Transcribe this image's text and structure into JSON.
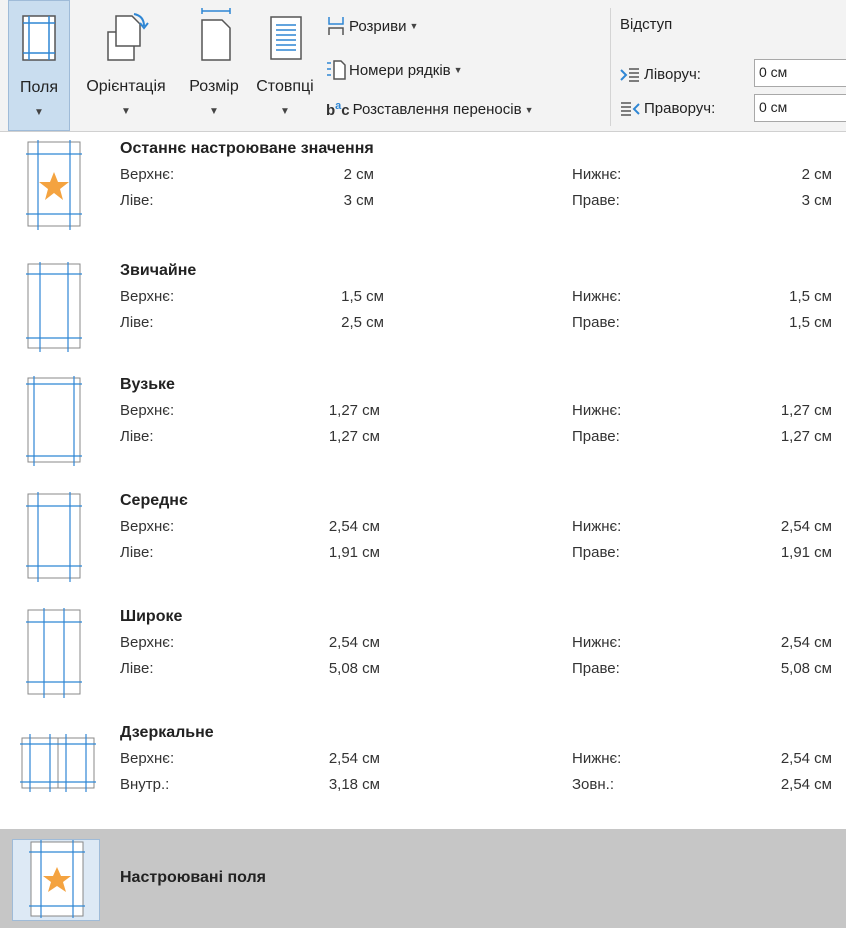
{
  "ribbon": {
    "fields_label": "Поля",
    "orientation_label": "Орієнтація",
    "size_label": "Розмір",
    "columns_label": "Стовпці",
    "breaks_label": "Розриви",
    "line_numbers_label": "Номери рядків",
    "hyphenation_label": "Розставлення переносів",
    "indent": {
      "title": "Відступ",
      "left_label": "Ліворуч:",
      "left_value": "0 см",
      "right_label": "Праворуч:",
      "right_value": "0 см"
    }
  },
  "presets": [
    {
      "name": "Останнє настроюване значення",
      "k1": "Верхнє:",
      "v1": "2 см",
      "k2": "Нижнє:",
      "v2": "2 см",
      "k3": "Ліве:",
      "v3": "3 см",
      "k4": "Праве:",
      "v4": "3 см",
      "icon": "page-star-icon"
    },
    {
      "name": "Звичайне",
      "k1": "Верхнє:",
      "v1": "1,5 см",
      "k2": "Нижнє:",
      "v2": "1,5 см",
      "k3": "Ліве:",
      "v3": "2,5 см",
      "k4": "Праве:",
      "v4": "1,5 см",
      "icon": "page-margins-icon"
    },
    {
      "name": "Вузьке",
      "k1": "Верхнє:",
      "v1": "1,27 см",
      "k2": "Нижнє:",
      "v2": "1,27 см",
      "k3": "Ліве:",
      "v3": "1,27 см",
      "k4": "Праве:",
      "v4": "1,27 см",
      "icon": "page-margins-icon"
    },
    {
      "name": "Середнє",
      "k1": "Верхнє:",
      "v1": "2,54 см",
      "k2": "Нижнє:",
      "v2": "2,54 см",
      "k3": "Ліве:",
      "v3": "1,91 см",
      "k4": "Праве:",
      "v4": "1,91 см",
      "icon": "page-margins-icon"
    },
    {
      "name": "Широке",
      "k1": "Верхнє:",
      "v1": "2,54 см",
      "k2": "Нижнє:",
      "v2": "2,54 см",
      "k3": "Ліве:",
      "v3": "5,08 см",
      "k4": "Праве:",
      "v4": "5,08 см",
      "icon": "page-margins-icon"
    },
    {
      "name": "Дзеркальне",
      "k1": "Верхнє:",
      "v1": "2,54 см",
      "k2": "Нижнє:",
      "v2": "2,54 см",
      "k3": "Внутр.:",
      "v3": "3,18 см",
      "k4": "Зовн.:",
      "v4": "2,54 см",
      "icon": "mirrored-pages-icon"
    }
  ],
  "custom": {
    "label": "Настроювані поля",
    "icon": "page-star-icon"
  },
  "colors": {
    "accent": "#2e86d4",
    "star": "#f4a340",
    "selected": "#c9ddef",
    "custom_bg": "#c6c6c6"
  }
}
